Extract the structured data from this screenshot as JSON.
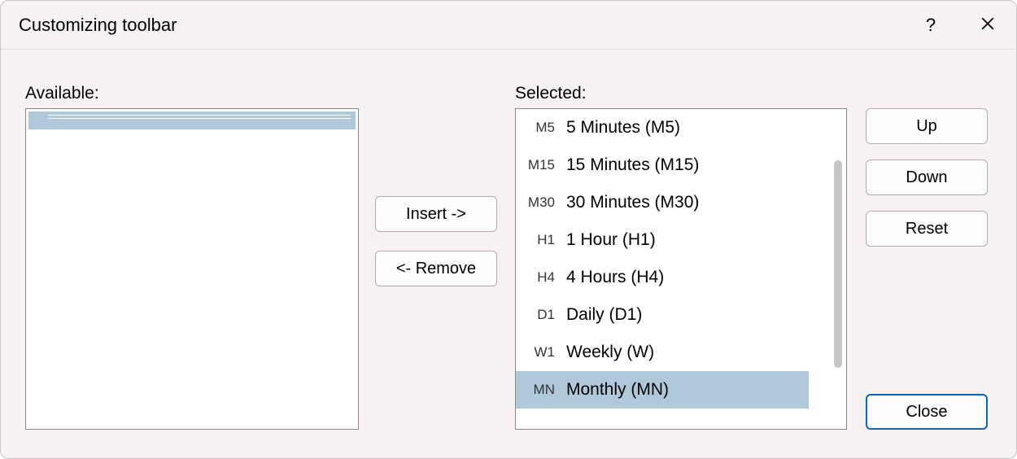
{
  "dialog": {
    "title": "Customizing toolbar"
  },
  "labels": {
    "available": "Available:",
    "selected": "Selected:"
  },
  "buttons": {
    "insert": "Insert ->",
    "remove": "<- Remove",
    "up": "Up",
    "down": "Down",
    "reset": "Reset",
    "close": "Close"
  },
  "available_items": [],
  "selected_items": [
    {
      "code": "M5",
      "label": "5 Minutes (M5)",
      "highlight": false
    },
    {
      "code": "M15",
      "label": "15 Minutes (M15)",
      "highlight": false
    },
    {
      "code": "M30",
      "label": "30 Minutes (M30)",
      "highlight": false
    },
    {
      "code": "H1",
      "label": "1 Hour (H1)",
      "highlight": false
    },
    {
      "code": "H4",
      "label": "4 Hours (H4)",
      "highlight": false
    },
    {
      "code": "D1",
      "label": "Daily (D1)",
      "highlight": false
    },
    {
      "code": "W1",
      "label": "Weekly (W)",
      "highlight": false
    },
    {
      "code": "MN",
      "label": "Monthly (MN)",
      "highlight": true
    }
  ]
}
